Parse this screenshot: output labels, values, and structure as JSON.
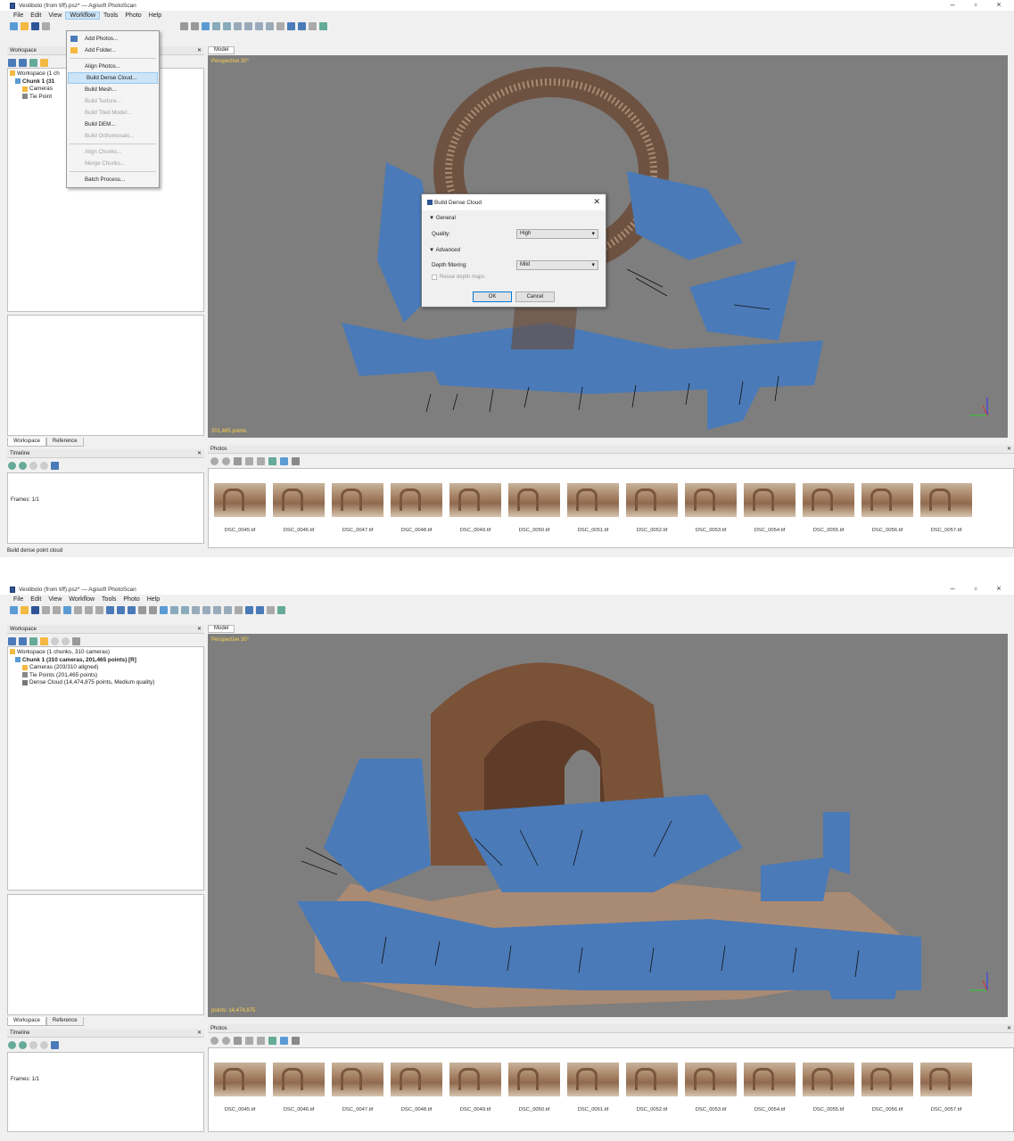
{
  "window": {
    "title": "Vestibolo (from tiff).psz* — Agisoft PhotoScan",
    "controls": [
      "–",
      "▫",
      "×"
    ]
  },
  "menu": [
    "File",
    "Edit",
    "View",
    "Workflow",
    "Tools",
    "Photo",
    "Help"
  ],
  "panels": {
    "workspace": "Workspace",
    "timeline": "Timeline",
    "photos": "Photos",
    "model_tab": "Model",
    "tab_workspace": "Workspace",
    "tab_reference": "Reference",
    "frames": "Frames: 1/1",
    "perspective": "Perspective 30°"
  },
  "workflow_menu": [
    {
      "label": "Add Photos...",
      "state": "enabled"
    },
    {
      "label": "Add Folder...",
      "state": "enabled"
    },
    {
      "label": "Align Photos...",
      "state": "enabled"
    },
    {
      "label": "Build Dense Cloud...",
      "state": "highlighted"
    },
    {
      "label": "Build Mesh...",
      "state": "enabled"
    },
    {
      "label": "Build Texture...",
      "state": "disabled"
    },
    {
      "label": "Build Tiled Model...",
      "state": "disabled"
    },
    {
      "label": "Build DEM...",
      "state": "enabled"
    },
    {
      "label": "Build Orthomosaic...",
      "state": "disabled"
    },
    {
      "label": "Align Chunks...",
      "state": "disabled"
    },
    {
      "label": "Merge Chunks...",
      "state": "disabled"
    },
    {
      "label": "Batch Process...",
      "state": "enabled"
    }
  ],
  "tree1": {
    "workspace": "Workspace (1 ch",
    "chunk": "Chunk 1 (31",
    "cameras": "Cameras",
    "tie": "Tie Point"
  },
  "tree2": {
    "workspace": "Workspace (1 chunks, 310 cameras)",
    "chunk": "Chunk 1 (310 cameras, 201,465 points) [R]",
    "cameras": "Cameras (203/310 aligned)",
    "tie": "Tie Points (201,465 points)",
    "dense": "Dense Cloud (14,474,875 points, Medium quality)"
  },
  "dialog": {
    "title": "Build Dense Cloud",
    "general": "General",
    "quality_label": "Quality:",
    "quality_value": "High",
    "advanced": "Advanced",
    "depth_label": "Depth filtering:",
    "depth_value": "Mild",
    "reuse": "Reuse depth maps",
    "ok": "OK",
    "cancel": "Cancel"
  },
  "viewport1": {
    "count": "201,465 points"
  },
  "viewport2": {
    "count": "points: 14,474,875"
  },
  "photos": [
    "DSC_0045.tif",
    "DSC_0046.tif",
    "DSC_0047.tif",
    "DSC_0048.tif",
    "DSC_0049.tif",
    "DSC_0050.tif",
    "DSC_0051.tif",
    "DSC_0052.tif",
    "DSC_0053.tif",
    "DSC_0054.tif",
    "DSC_0055.tif",
    "DSC_0056.tif",
    "DSC_0057.tif"
  ],
  "status1": "Build dense point cloud",
  "colors": {
    "accent": "#4a7ab8",
    "label": "#ffd24d",
    "viewport_bg": "#7e7e7e"
  }
}
